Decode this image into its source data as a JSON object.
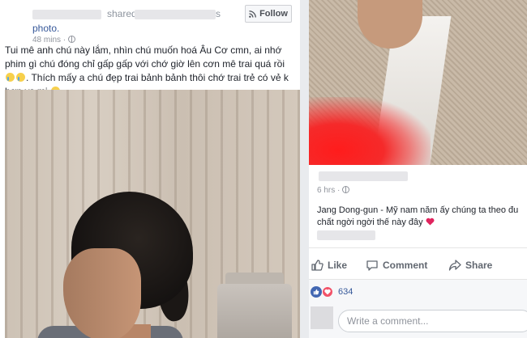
{
  "left_post": {
    "shared_word": "shared",
    "s_word": "s",
    "photo_link": "photo.",
    "time": "48 mins ·",
    "follow_label": "Follow",
    "body": "Tui mê anh chú này lắm, nhìn chú muốn hoá Âu Cơ cmn, ai nhớ phim gì chú đóng chỉ gấp gấp với chớ giờ lên cơn mê trai quá rồi",
    "body_cont": ". Thích mấy a chú đẹp trai bảnh bảnh thôi chớ trai trẻ có vẻ k hợp vs mị"
  },
  "right_post": {
    "reply_time": "6 hrs ·",
    "reply_text_line1": "Jang Dong-gun - Mỹ nam năm ấy chúng ta theo đu",
    "reply_text_line2": "chất ngời ngời thế này đây",
    "actions": {
      "like": "Like",
      "comment": "Comment",
      "share": "Share"
    },
    "reaction_count": "634",
    "comment_placeholder": "Write a comment..."
  },
  "colors": {
    "facebook_blue": "#4267b2",
    "link_blue": "#365899",
    "love_red": "#f25268",
    "meta_gray": "#90949c"
  }
}
